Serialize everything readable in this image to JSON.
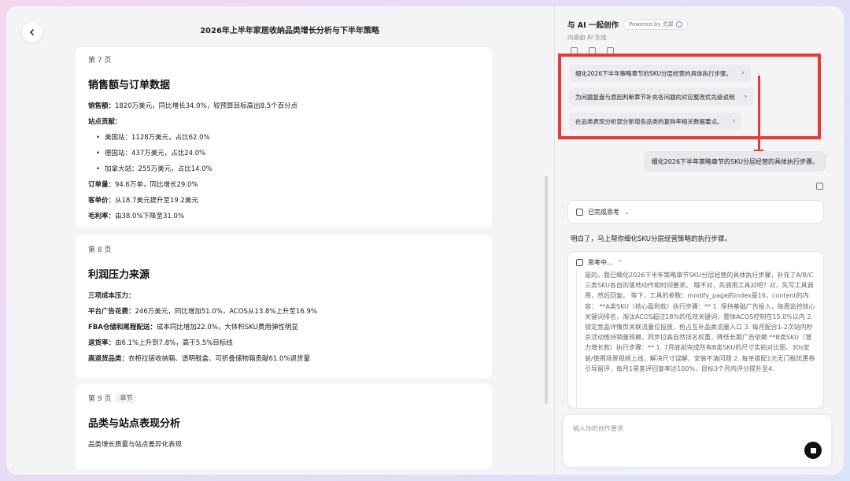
{
  "doc": {
    "title": "2026年上半年家居收纳品类增长分析与下半年策略",
    "cards": [
      {
        "page": "第 7 页",
        "heading": "销售额与订单数据",
        "lines": [
          {
            "label": "销售额：",
            "text": "1820万美元，同比增长34.0%，较预算目标高出8.5个百分点"
          },
          {
            "label": "站点贡献：",
            "text": ""
          },
          {
            "bullet": "美国站：1128万美元，占比62.0%"
          },
          {
            "bullet": "德国站：437万美元，占比24.0%"
          },
          {
            "bullet": "加拿大站：255万美元，占比14.0%"
          },
          {
            "label": "订单量：",
            "text": "94.6万单，同比增长29.0%"
          },
          {
            "label": "客单价：",
            "text": "从18.7美元提升至19.2美元"
          },
          {
            "label": "毛利率：",
            "text": "由38.0%下降至31.0%"
          }
        ]
      },
      {
        "page": "第 8 页",
        "heading": "利润压力来源",
        "lines": [
          {
            "label": "三项成本压力：",
            "text": ""
          },
          {
            "label": "平台广告花费：",
            "text": "246万美元，同比增加51.0%，ACOS从13.8%上升至16.9%"
          },
          {
            "label": "FBA仓储和尾程配送：",
            "text": "成本同比增加22.0%，大体积SKU费用弹性明显"
          },
          {
            "label": "退货率：",
            "text": "由6.1%上升到7.8%，高于5.5%目标线"
          },
          {
            "label": "高退货品类：",
            "text": "衣柜拉链收纳箱、透明鞋盒、可折叠储物箱贡献61.0%退货量"
          }
        ]
      },
      {
        "page": "第 9 页",
        "tag": "章节",
        "heading": "品类与站点表现分析",
        "lines": [
          {
            "label": "",
            "text": "品类增长质量与站点差异化表现"
          }
        ]
      }
    ]
  },
  "ai": {
    "title": "与 AI 一起创作",
    "powered": "Powered by 灵犀",
    "subtitle": "内容由 AI 生成",
    "suggestions": [
      "细化2026下半年策略章节的SKU分层经营的具体执行步骤。",
      "为问题复盘与原因判断章节补充各问题的对应整改优先级说明",
      "在品类表现分析部分新增各品类的复购率相关数据要点。"
    ],
    "user_message": "细化2026下半年策略章节的SKU分层经营的具体执行步骤。",
    "thinking_done": "已完成思考",
    "reply": "明白了，马上帮你细化SKU分层经营策略的执行步骤。",
    "thinking_label": "思考中...",
    "thinking_text": "是的，我已细化2026下半年策略章节SKU分层经营的具体执行步骤，补充了A/B/C三类SKU各自的落地动作和时间要求。 哦不对，先调用工具对吧？对，先写工具调用，然后回复。 等下，工具的参数：modify_page的index是16，content的内容： **A类SKU（核心盈利款）执行步骤：** 1. 保持基础广告投入，每周监控核心关键词排名，淘汰ACOS超过18%的低效关键词，整体ACOS控制在15.0%以内 2. 锁定竞品详情页关联流量位投放，抢占互补品类流量入口 3. 每月配合1-2次站内秒杀活动维持销量规模，同步拉高自然排名权重，降低长期广告依赖 **B类SKU（潜力增长款）执行步骤：** 1. 7月底前完成所有B类SKU的尺寸实拍对比图、30s安装/使用场景视频上线，解决尺寸误解、安装不清问题 2. 每单搭配1元无门槛优惠券引导留评，每月1星差评回复率达100%，目标3个月内评分提升至4.",
    "input_placeholder": "输入你的创作要求"
  }
}
